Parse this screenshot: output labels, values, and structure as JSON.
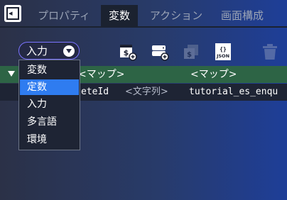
{
  "tabs": [
    {
      "label": "プロパティ",
      "active": false
    },
    {
      "label": "変数",
      "active": true
    },
    {
      "label": "アクション",
      "active": false
    },
    {
      "label": "画面構成",
      "active": false
    }
  ],
  "type_select": {
    "value": "入力"
  },
  "dropdown": {
    "options": [
      "変数",
      "定数",
      "入力",
      "多言語",
      "環境"
    ],
    "selected": "定数"
  },
  "toolbar": {
    "icons": [
      "add-variable-icon",
      "add-database-icon",
      "copy-variable-icon",
      "json-icon",
      "trash-icon"
    ]
  },
  "table": {
    "header": {
      "col1": "<マップ>",
      "col2": "<マップ>"
    },
    "row": {
      "name": "eteId",
      "type": "<文字列>",
      "value": "tutorial_es_enqu"
    }
  },
  "colors": {
    "accent_border": "#7b73ff",
    "selected_option": "#2f7cf0",
    "header_row": "#2d6445",
    "tab_active_bg": "#1b2230"
  }
}
